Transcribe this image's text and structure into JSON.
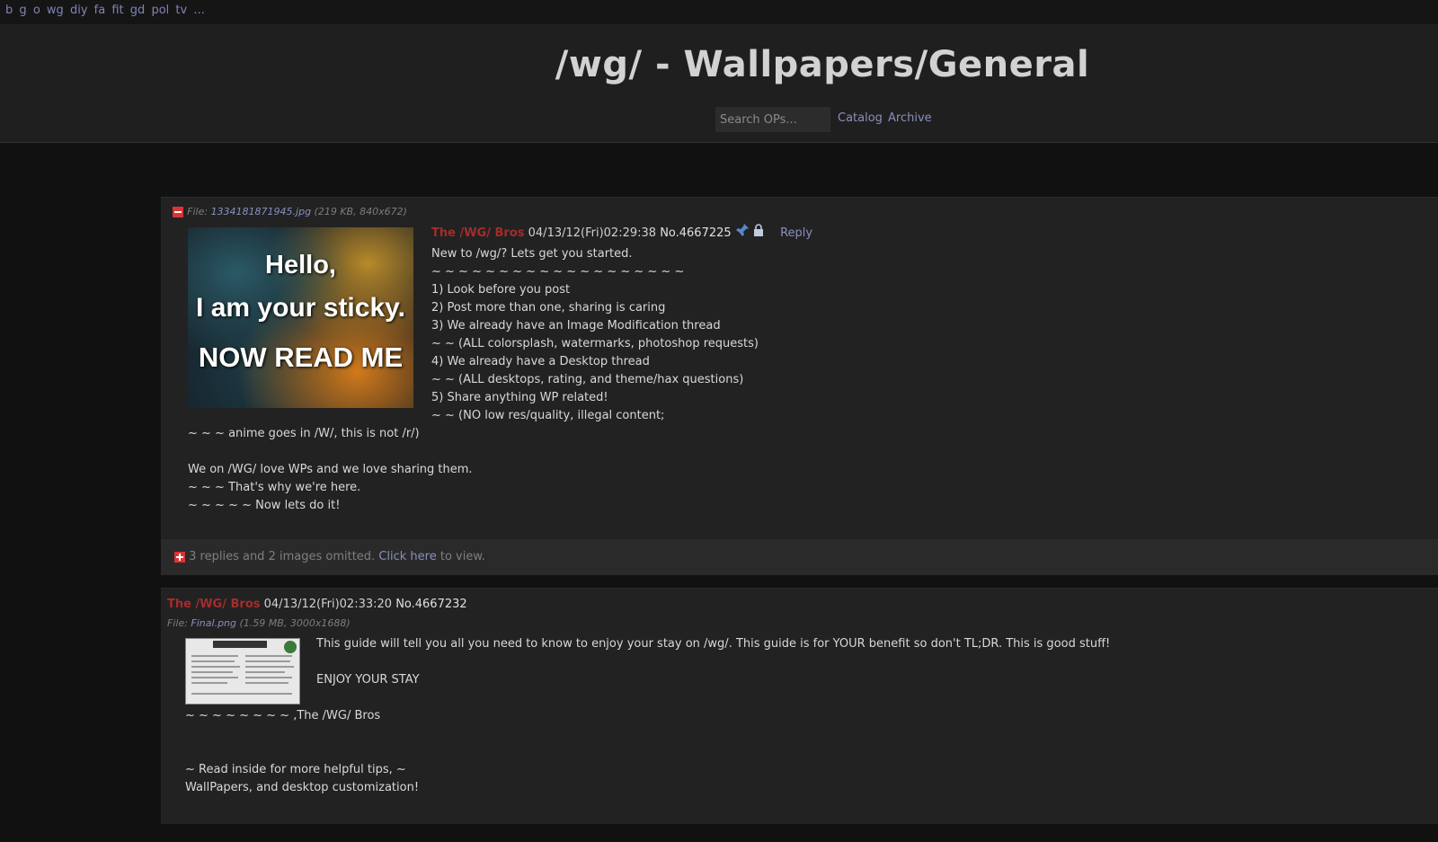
{
  "boardnav": {
    "boards": [
      "b",
      "g",
      "o",
      "wg",
      "diy",
      "fa",
      "fit",
      "gd",
      "pol",
      "tv"
    ],
    "more": "..."
  },
  "header": {
    "title": "/wg/ - Wallpapers/General",
    "search_placeholder": "Search OPs...",
    "catalog_label": "Catalog",
    "archive_label": "Archive"
  },
  "thread1": {
    "file_prefix": "File: ",
    "file_name": "1334181871945.jpg",
    "file_meta": " (219 KB, 840x672)",
    "thumb_lines": [
      "Hello,",
      "I am your sticky.",
      "NOW READ ME"
    ],
    "name": "The /WG/ Bros",
    "datetime": "04/13/12(Fri)02:29:38",
    "post_no": "No.4667225",
    "reply_label": "Reply",
    "pin_icon": "pin-icon",
    "lock_icon": "lock-icon",
    "body_side": [
      "New to /wg/? Lets get you started.",
      "~ ~ ~ ~ ~ ~ ~ ~ ~ ~ ~ ~ ~ ~ ~ ~ ~ ~ ~",
      "1) Look before you post",
      "2) Post more than one, sharing is caring",
      "3) We already have an Image Modification thread",
      "~ ~ (ALL colorsplash, watermarks, photoshop requests)",
      "4) We already have a Desktop thread",
      "~ ~ (ALL desktops, rating, and theme/hax questions)",
      "5) Share anything WP related!",
      "~ ~ (NO low res/quality, illegal content;"
    ],
    "body_below": [
      "~ ~ ~ anime goes in /W/, this is not /r/)",
      "",
      "We on /WG/ love WPs and we love sharing them.",
      "~ ~ ~ That's why we're here.",
      "~ ~ ~ ~ ~ Now lets do it!"
    ],
    "omitted_text": "3 replies and 2 images omitted. ",
    "omitted_link": "Click here",
    "omitted_suffix": " to view."
  },
  "thread2": {
    "name": "The /WG/ Bros",
    "datetime": "04/13/12(Fri)02:33:20",
    "post_no": "No.4667232",
    "file_prefix": "File: ",
    "file_name": "Final.png",
    "file_meta": " (1.59 MB, 3000x1688)",
    "body_side": [
      "This guide will tell you all you need to know to enjoy your stay on /wg/. This guide is for YOUR benefit so don't TL;DR. This is good stuff!",
      "",
      "ENJOY YOUR STAY"
    ],
    "body_below": [
      "~ ~ ~ ~ ~ ~ ~ ~ ,The /WG/ Bros",
      "",
      "",
      "~ Read inside for more helpful tips, ~",
      "WallPapers, and desktop customization!"
    ]
  },
  "colors": {
    "name": "#a52c2c",
    "link": "#8a8fbe",
    "background": "#111111",
    "post_bg": "#222222"
  }
}
